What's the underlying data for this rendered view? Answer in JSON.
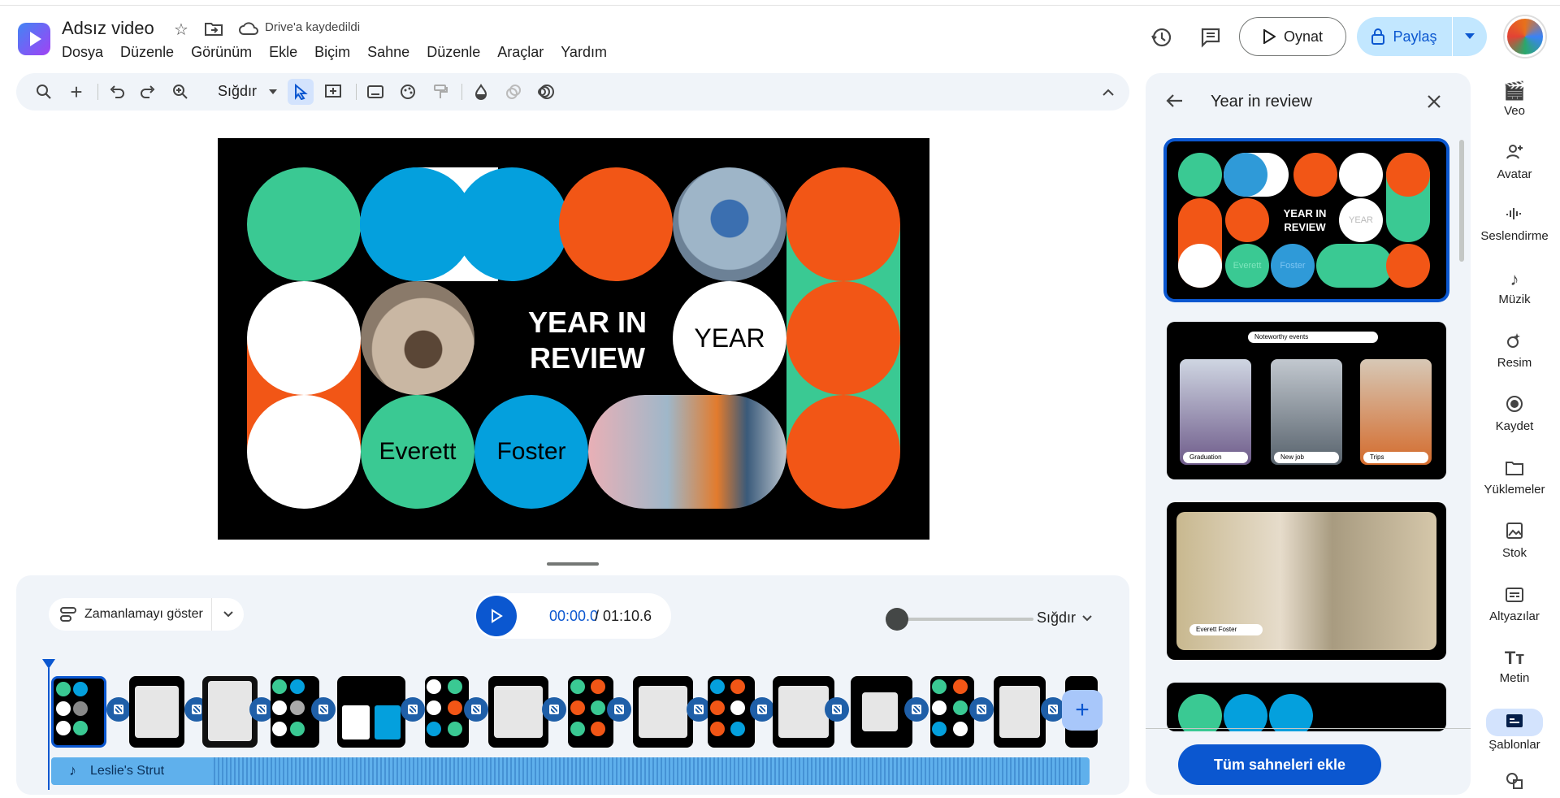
{
  "header": {
    "doc_title": "Adsız video",
    "save_status": "Drive'a kaydedildi",
    "menu": [
      "Dosya",
      "Düzenle",
      "Görünüm",
      "Ekle",
      "Biçim",
      "Sahne",
      "Düzenle",
      "Araçlar",
      "Yardım"
    ],
    "play_label": "Oynat",
    "share_label": "Paylaş"
  },
  "toolbar": {
    "zoom_label": "Sığdır"
  },
  "slide": {
    "title_line1": "YEAR IN",
    "title_line2": "REVIEW",
    "circle_year": "YEAR",
    "circle_name1": "Everett",
    "circle_name2": "Foster"
  },
  "timeline": {
    "show_timing": "Zamanlamayı göster",
    "time_current": "00:00.0",
    "time_total": "/ 01:10.6",
    "zoom_fit": "Sığdır",
    "audio_name": "Leslie's Strut"
  },
  "panel": {
    "title": "Year in review",
    "add_all": "Tüm sahneleri ekle",
    "t1_title": "YEAR IN REVIEW",
    "t1_year": "YEAR",
    "t1_name1": "Everett",
    "t1_name2": "Foster",
    "t2_header": "Noteworthy events",
    "t2_labels": [
      "Graduation",
      "New job",
      "Trips"
    ],
    "t3_label": "Everett Foster"
  },
  "rail": [
    {
      "label": "Veo",
      "icon": "veo-icon"
    },
    {
      "label": "Avatar",
      "icon": "avatar-icon"
    },
    {
      "label": "Seslendirme",
      "icon": "voiceover-icon"
    },
    {
      "label": "Müzik",
      "icon": "music-icon"
    },
    {
      "label": "Resim",
      "icon": "image-icon"
    },
    {
      "label": "Kaydet",
      "icon": "record-icon"
    },
    {
      "label": "Yüklemeler",
      "icon": "folder-icon"
    },
    {
      "label": "Stok",
      "icon": "stock-icon"
    },
    {
      "label": "Altyazılar",
      "icon": "captions-icon"
    },
    {
      "label": "Metin",
      "icon": "text-icon"
    },
    {
      "label": "Şablonlar",
      "icon": "templates-icon"
    }
  ],
  "colors": {
    "green": "#3ac993",
    "blue": "#04a0dd",
    "orange": "#f25616",
    "accent": "#0b57d0"
  }
}
